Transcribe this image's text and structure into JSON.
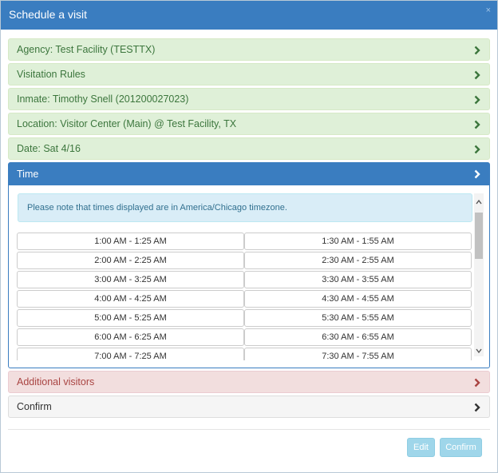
{
  "modal": {
    "title": "Schedule a visit",
    "close_glyph": "×"
  },
  "sections": {
    "agency": "Agency: Test Facility (TESTTX)",
    "rules": "Visitation Rules",
    "inmate": "Inmate: Timothy Snell (201200027023)",
    "location": "Location: Visitor Center (Main) @ Test Facility, TX",
    "date": "Date: Sat 4/16",
    "time": "Time",
    "additional_visitors": "Additional visitors",
    "confirm": "Confirm"
  },
  "time": {
    "notice": "Please note that times displayed are in America/Chicago timezone.",
    "slots": [
      [
        "1:00 AM - 1:25 AM",
        "1:30 AM - 1:55 AM"
      ],
      [
        "2:00 AM - 2:25 AM",
        "2:30 AM - 2:55 AM"
      ],
      [
        "3:00 AM - 3:25 AM",
        "3:30 AM - 3:55 AM"
      ],
      [
        "4:00 AM - 4:25 AM",
        "4:30 AM - 4:55 AM"
      ],
      [
        "5:00 AM - 5:25 AM",
        "5:30 AM - 5:55 AM"
      ],
      [
        "6:00 AM - 6:25 AM",
        "6:30 AM - 6:55 AM"
      ],
      [
        "7:00 AM - 7:25 AM",
        "7:30 AM - 7:55 AM"
      ]
    ]
  },
  "footer": {
    "edit_label": "Edit",
    "confirm_label": "Confirm"
  },
  "icons": {
    "section_chevron": "chevron-right-icon",
    "close": "close-icon",
    "scroll_up": "chevron-up-icon",
    "scroll_down": "chevron-down-icon"
  },
  "colors": {
    "primary": "#3a7dc0",
    "success_bg": "#dff0d8",
    "success_text": "#3c763d",
    "danger_bg": "#f2dede",
    "danger_text": "#a94442",
    "info_bg": "#d9edf7",
    "info_text": "#31708f",
    "button_disabled": "#9fd6ea"
  }
}
